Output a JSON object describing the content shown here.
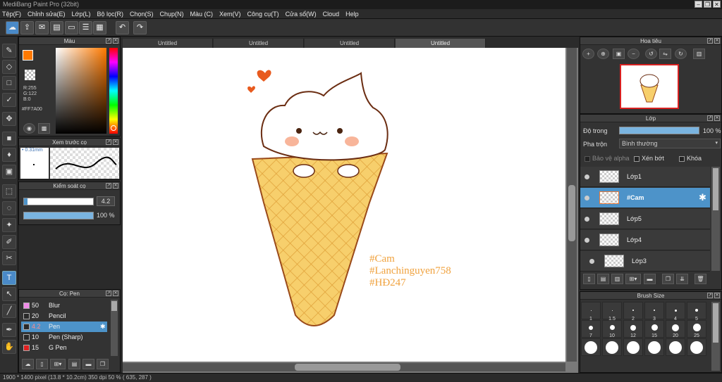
{
  "app": {
    "title": "MediBang Paint Pro (32bit)"
  },
  "menu": [
    "Tệp(F)",
    "Chỉnh sửa(E)",
    "Lớp(L)",
    "Bộ lọc(R)",
    "Chọn(S)",
    "Chụp(N)",
    "Màu (C)",
    "Xem(V)",
    "Công cụ(T)",
    "Cửa sổ(W)",
    "Cloud",
    "Help"
  ],
  "color_panel": {
    "title": "Màu",
    "r": "R:255",
    "g": "G:122",
    "b": "B:0",
    "hex": "#FF7A00",
    "fg": "#ff7a00"
  },
  "brush_preview": {
    "title": "Xem trước cọ",
    "size": "0.31mm"
  },
  "brush_control": {
    "title": "Kiểm soát cọ",
    "size_value": "4.2",
    "opacity_value": "100 %"
  },
  "brush_list": {
    "title": "Cọ: Pen",
    "items": [
      {
        "size": "50",
        "name": "Blur",
        "color": "#f08be8"
      },
      {
        "size": "20",
        "name": "Pencil",
        "color": "#2a2a2a"
      },
      {
        "size": "4.2",
        "name": "Pen",
        "color": "#2a2a2a",
        "selected": true
      },
      {
        "size": "10",
        "name": "Pen (Sharp)",
        "color": "#2a2a2a"
      },
      {
        "size": "15",
        "name": "G Pen",
        "color": "#e02020"
      }
    ]
  },
  "tabs": [
    "Untitled",
    "Untitled",
    "Untitled",
    "Untitled"
  ],
  "canvas_text": [
    "#Cam",
    "#Lanchinguyen758",
    "#HĐ247"
  ],
  "navigator": {
    "title": "Hoa tiêu"
  },
  "layer_panel": {
    "title": "Lớp",
    "opacity_label": "Độ trong",
    "opacity_value": "100 %",
    "blend_label": "Pha trộn",
    "blend_value": "Bình thường",
    "protect_alpha": "Bảo vệ alpha",
    "clipping": "Xén bớt",
    "lock": "Khóa",
    "layers": [
      {
        "name": "Lớp1"
      },
      {
        "name": "#Cam",
        "selected": true
      },
      {
        "name": "Lớp5"
      },
      {
        "name": "Lớp4"
      },
      {
        "name": "Lớp3"
      }
    ]
  },
  "brush_size": {
    "title": "Brush Size",
    "sizes": [
      "1",
      "1.5",
      "2",
      "3",
      "4",
      "5",
      "7",
      "10",
      "12",
      "15",
      "20",
      "25"
    ]
  },
  "status": {
    "text": "1900 * 1400 pixel   (13.8 * 10.2cm)   350 dpi   50 %   ( 635, 287 )"
  }
}
